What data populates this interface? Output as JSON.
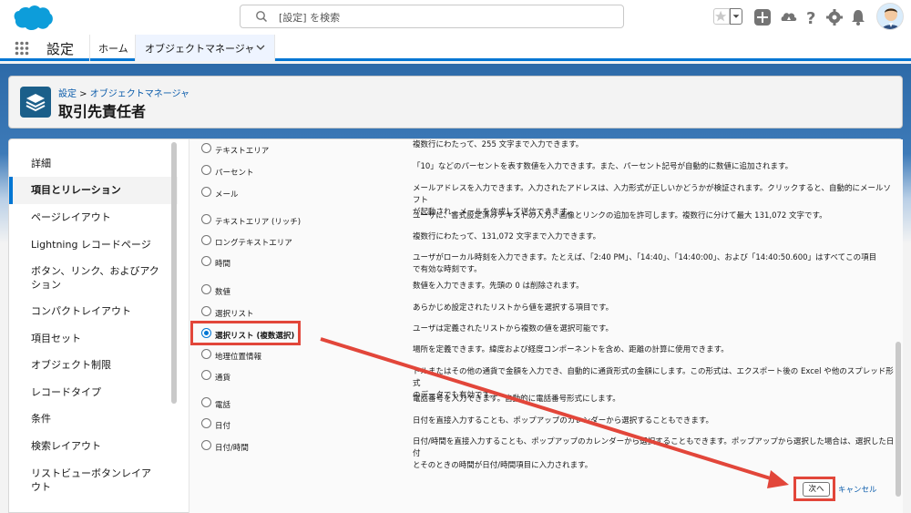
{
  "header": {
    "search_placeholder": "[設定] を検索"
  },
  "nav": {
    "app_name": "設定",
    "home": "ホーム",
    "active_tab": "オブジェクトマネージャ"
  },
  "page_header": {
    "breadcrumb_root": "設定",
    "breadcrumb_sep": " > ",
    "breadcrumb_current": "オブジェクトマネージャ",
    "title": "取引先責任者"
  },
  "sidebar": {
    "items": [
      {
        "label": "詳細"
      },
      {
        "label": "項目とリレーション"
      },
      {
        "label": "ページレイアウト"
      },
      {
        "label": "Lightning レコードページ"
      },
      {
        "label": "ボタン、リンク、およびアク"
      },
      {
        "label": "ション"
      },
      {
        "label": "コンパクトレイアウト"
      },
      {
        "label": "項目セット"
      },
      {
        "label": "オブジェクト制限"
      },
      {
        "label": "レコードタイプ"
      },
      {
        "label": "条件"
      },
      {
        "label": "検索レイアウト"
      },
      {
        "label": "リストビューボタンレイア"
      },
      {
        "label": "ウト"
      }
    ]
  },
  "field_types": [
    {
      "label": "テキストエリア",
      "desc1": "複数行にわたって、255 文字まで入力できます。",
      "desc2": ""
    },
    {
      "label": "パーセント",
      "desc1": "「10」などのパーセントを表す数値を入力できます。また、パーセント記号が自動的に数値に追加されます。",
      "desc2": ""
    },
    {
      "label": "メール",
      "desc1": "メールアドレスを入力できます。入力されたアドレスは、入力形式が正しいかどうかが検証されます。クリックすると、自動的にメールソフト",
      "desc2": "が起動され、メールを作成して送信できます。"
    },
    {
      "label": "テキストエリア (リッチ)",
      "desc1": "ユーザに、書式設定済みテキストの入力、画像とリンクの追加を許可します。複数行に分けて最大 131,072 文字です。",
      "desc2": ""
    },
    {
      "label": "ロングテキストエリア",
      "desc1": "複数行にわたって、131,072 文字まで入力できます。",
      "desc2": ""
    },
    {
      "label": "時間",
      "desc1": "ユーザがローカル時刻を入力できます。たとえば、「2:40 PM」、「14:40」、「14:40:00」、および「14:40:50.600」はすべてこの項目",
      "desc2": "で有効な時刻です。"
    },
    {
      "label": "数値",
      "desc1": "数値を入力できます。先頭の 0 は削除されます。",
      "desc2": ""
    },
    {
      "label": "選択リスト",
      "desc1": "あらかじめ設定されたリストから値を選択する項目です。",
      "desc2": ""
    },
    {
      "label": "選択リスト (複数選択)",
      "desc1": "ユーザは定義されたリストから複数の値を選択可能です。",
      "desc2": ""
    },
    {
      "label": "地理位置情報",
      "desc1": "場所を定義できます。緯度および経度コンポーネントを含め、距離の計算に使用できます。",
      "desc2": ""
    },
    {
      "label": "通貨",
      "desc1": "ドルまたはその他の通貨で金額を入力でき、自動的に通貨形式の金額にします。この形式は、エクスポート後の Excel や他のスプレッド形式",
      "desc2": "のデータでも有効です。"
    },
    {
      "label": "電話",
      "desc1": "電話番号を入力できます。自動的に電話番号形式にします。",
      "desc2": ""
    },
    {
      "label": "日付",
      "desc1": "日付を直接入力することも、ポップアップのカレンダーから選択することもできます。",
      "desc2": ""
    },
    {
      "label": "日付/時間",
      "desc1": "日付/時間を直接入力することも、ポップアップのカレンダーから選択することもできます。ポップアップから選択した場合は、選択した日付",
      "desc2": "とそのときの時間が日付/時間項目に入力されます。"
    }
  ],
  "selected_index": 8,
  "footer": {
    "next": "次へ",
    "cancel": "キャンセル"
  },
  "colors": {
    "brand_blue": "#0176d3",
    "highlight_red": "#e2463a",
    "link_blue": "#0b5cab"
  },
  "icons": {
    "logo": "salesforce-cloud-logo",
    "search": "search-icon",
    "favorites": "star-icon",
    "add": "plus-icon",
    "trailhead": "trailhead-icon",
    "help": "question-icon",
    "settings": "gear-icon",
    "notifications": "bell-icon",
    "launcher": "app-launcher-icon",
    "object": "layers-icon"
  }
}
